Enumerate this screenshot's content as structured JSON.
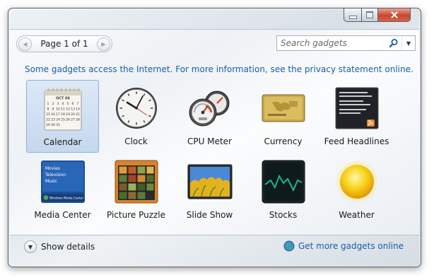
{
  "pager": {
    "label": "Page 1 of 1"
  },
  "search": {
    "placeholder": "Search gadgets"
  },
  "notice": "Some gadgets access the Internet.  For more information, see the privacy statement online.",
  "gadgets": [
    {
      "label": "Calendar",
      "selected": true,
      "month": "OCT 06",
      "days": [
        "1",
        "2",
        "3",
        "4",
        "5",
        "6",
        "7",
        "8",
        "9",
        "10",
        "11",
        "12",
        "13",
        "14",
        "15",
        "16",
        "17",
        "18",
        "19",
        "20",
        "21",
        "22",
        "23",
        "24",
        "25",
        "26",
        "27",
        "28",
        "29",
        "30",
        "31"
      ]
    },
    {
      "label": "Clock"
    },
    {
      "label": "CPU Meter"
    },
    {
      "label": "Currency"
    },
    {
      "label": "Feed Headlines"
    },
    {
      "label": "Media Center",
      "menu": [
        "Movies",
        "Television",
        "Music"
      ],
      "footer": "Windows Media Center"
    },
    {
      "label": "Picture Puzzle"
    },
    {
      "label": "Slide Show"
    },
    {
      "label": "Stocks"
    },
    {
      "label": "Weather"
    }
  ],
  "footer": {
    "details_label": "Show details",
    "more_link": "Get more gadgets online"
  },
  "colors": {
    "link": "#1a5fa7",
    "selection": "#c5d8ef",
    "close": "#c9462c"
  }
}
